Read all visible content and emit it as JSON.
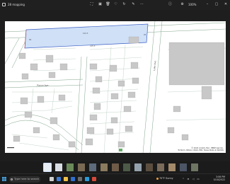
{
  "window": {
    "title": "28 mapping",
    "zoom": "100%"
  },
  "toolbar": {
    "icons": [
      "fullscreen-icon",
      "crop-icon",
      "delete-icon",
      "favorite-icon",
      "rotate-icon",
      "edit-icon",
      "more-icon",
      "info-icon",
      "zoom-in-icon"
    ]
  },
  "map": {
    "highlight_color": "#cfe0f7",
    "highlight_stroke": "#3b5fc4",
    "street_labels": [
      "Pierce Ave",
      "Lake Ave"
    ],
    "lot_labels": [
      "104.5",
      "80",
      "115.3",
      "95"
    ],
    "attribution_line1": "© 2022 ArcGIS. Esri, HERE Garmin,",
    "attribution_line2": "Tomtom, NOAA, USGS, EPA, Texas Parks & Wildlife"
  },
  "filmstrip": {
    "count": 14
  },
  "taskbar": {
    "search_placeholder": "Type here to search",
    "weather_temp": "70°F",
    "weather_text": "Sunny",
    "time": "3:06 PM",
    "date": "5/18/2022"
  }
}
